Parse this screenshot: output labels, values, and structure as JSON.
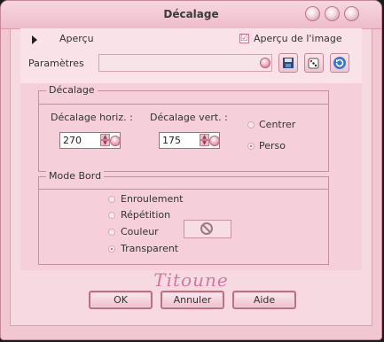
{
  "window": {
    "title": "Décalage"
  },
  "top": {
    "apercu_label": "Aperçu",
    "apercu_image_label": "Aperçu de l'image",
    "apercu_image_checked": "☑",
    "parametres_label": "Paramètres",
    "parametres_value": ""
  },
  "decalage": {
    "title": "Décalage",
    "horiz_label": "Décalage horiz. :",
    "horiz_value": "270",
    "vert_label": "Décalage vert. :",
    "vert_value": "175",
    "centrer_label": "Centrer",
    "perso_label": "Perso",
    "selected": "Perso"
  },
  "mode_bord": {
    "title": "Mode Bord",
    "options": [
      "Enroulement",
      "Répétition",
      "Couleur",
      "Transparent"
    ],
    "selected": "Transparent"
  },
  "signature": "Titoune",
  "buttons": {
    "ok": "OK",
    "cancel": "Annuler",
    "help": "Aide"
  },
  "colors": {
    "window": "#f2c7d2",
    "border": "#c58f9f",
    "accent": "#d079a3"
  }
}
